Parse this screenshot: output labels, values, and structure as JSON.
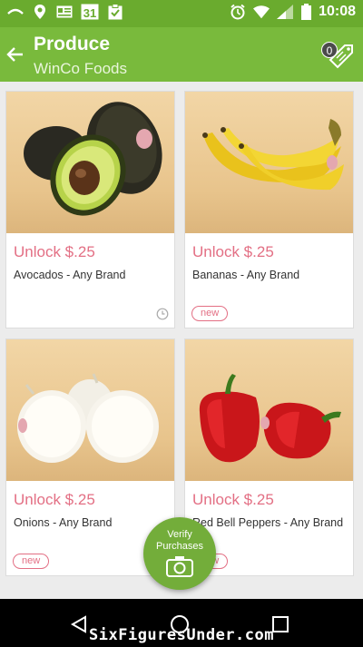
{
  "status_bar": {
    "time": "10:08",
    "icons": [
      "rss-feed-icon",
      "location-pin-icon",
      "id-card-icon",
      "calendar-icon",
      "clipboard-check-icon",
      "alarm-icon",
      "wifi-icon",
      "signal-icon",
      "battery-icon"
    ],
    "calendar_day": "31"
  },
  "app_bar": {
    "title": "Produce",
    "subtitle": "WinCo Foods",
    "cart_count": "0"
  },
  "products": [
    {
      "offer": "Unlock $.25",
      "name": "Avocados - Any Brand",
      "tag": "",
      "image_icon": "avocado-icon"
    },
    {
      "offer": "Unlock $.25",
      "name": "Bananas - Any Brand",
      "tag": "new",
      "image_icon": "bananas-icon"
    },
    {
      "offer": "Unlock $.25",
      "name": "Onions - Any Brand",
      "tag": "new",
      "image_icon": "onions-icon"
    },
    {
      "offer": "Unlock $.25",
      "name": "Red Bell Peppers - Any Brand",
      "tag": "new",
      "image_icon": "red-peppers-icon"
    }
  ],
  "fab": {
    "line1": "Verify",
    "line2": "Purchases"
  },
  "watermark": "SixFiguresUnder.com",
  "colors": {
    "status_bar": "#6aab2e",
    "app_bar": "#79ba3c",
    "accent_pink": "#e36f84",
    "fab": "#73ad3a"
  }
}
